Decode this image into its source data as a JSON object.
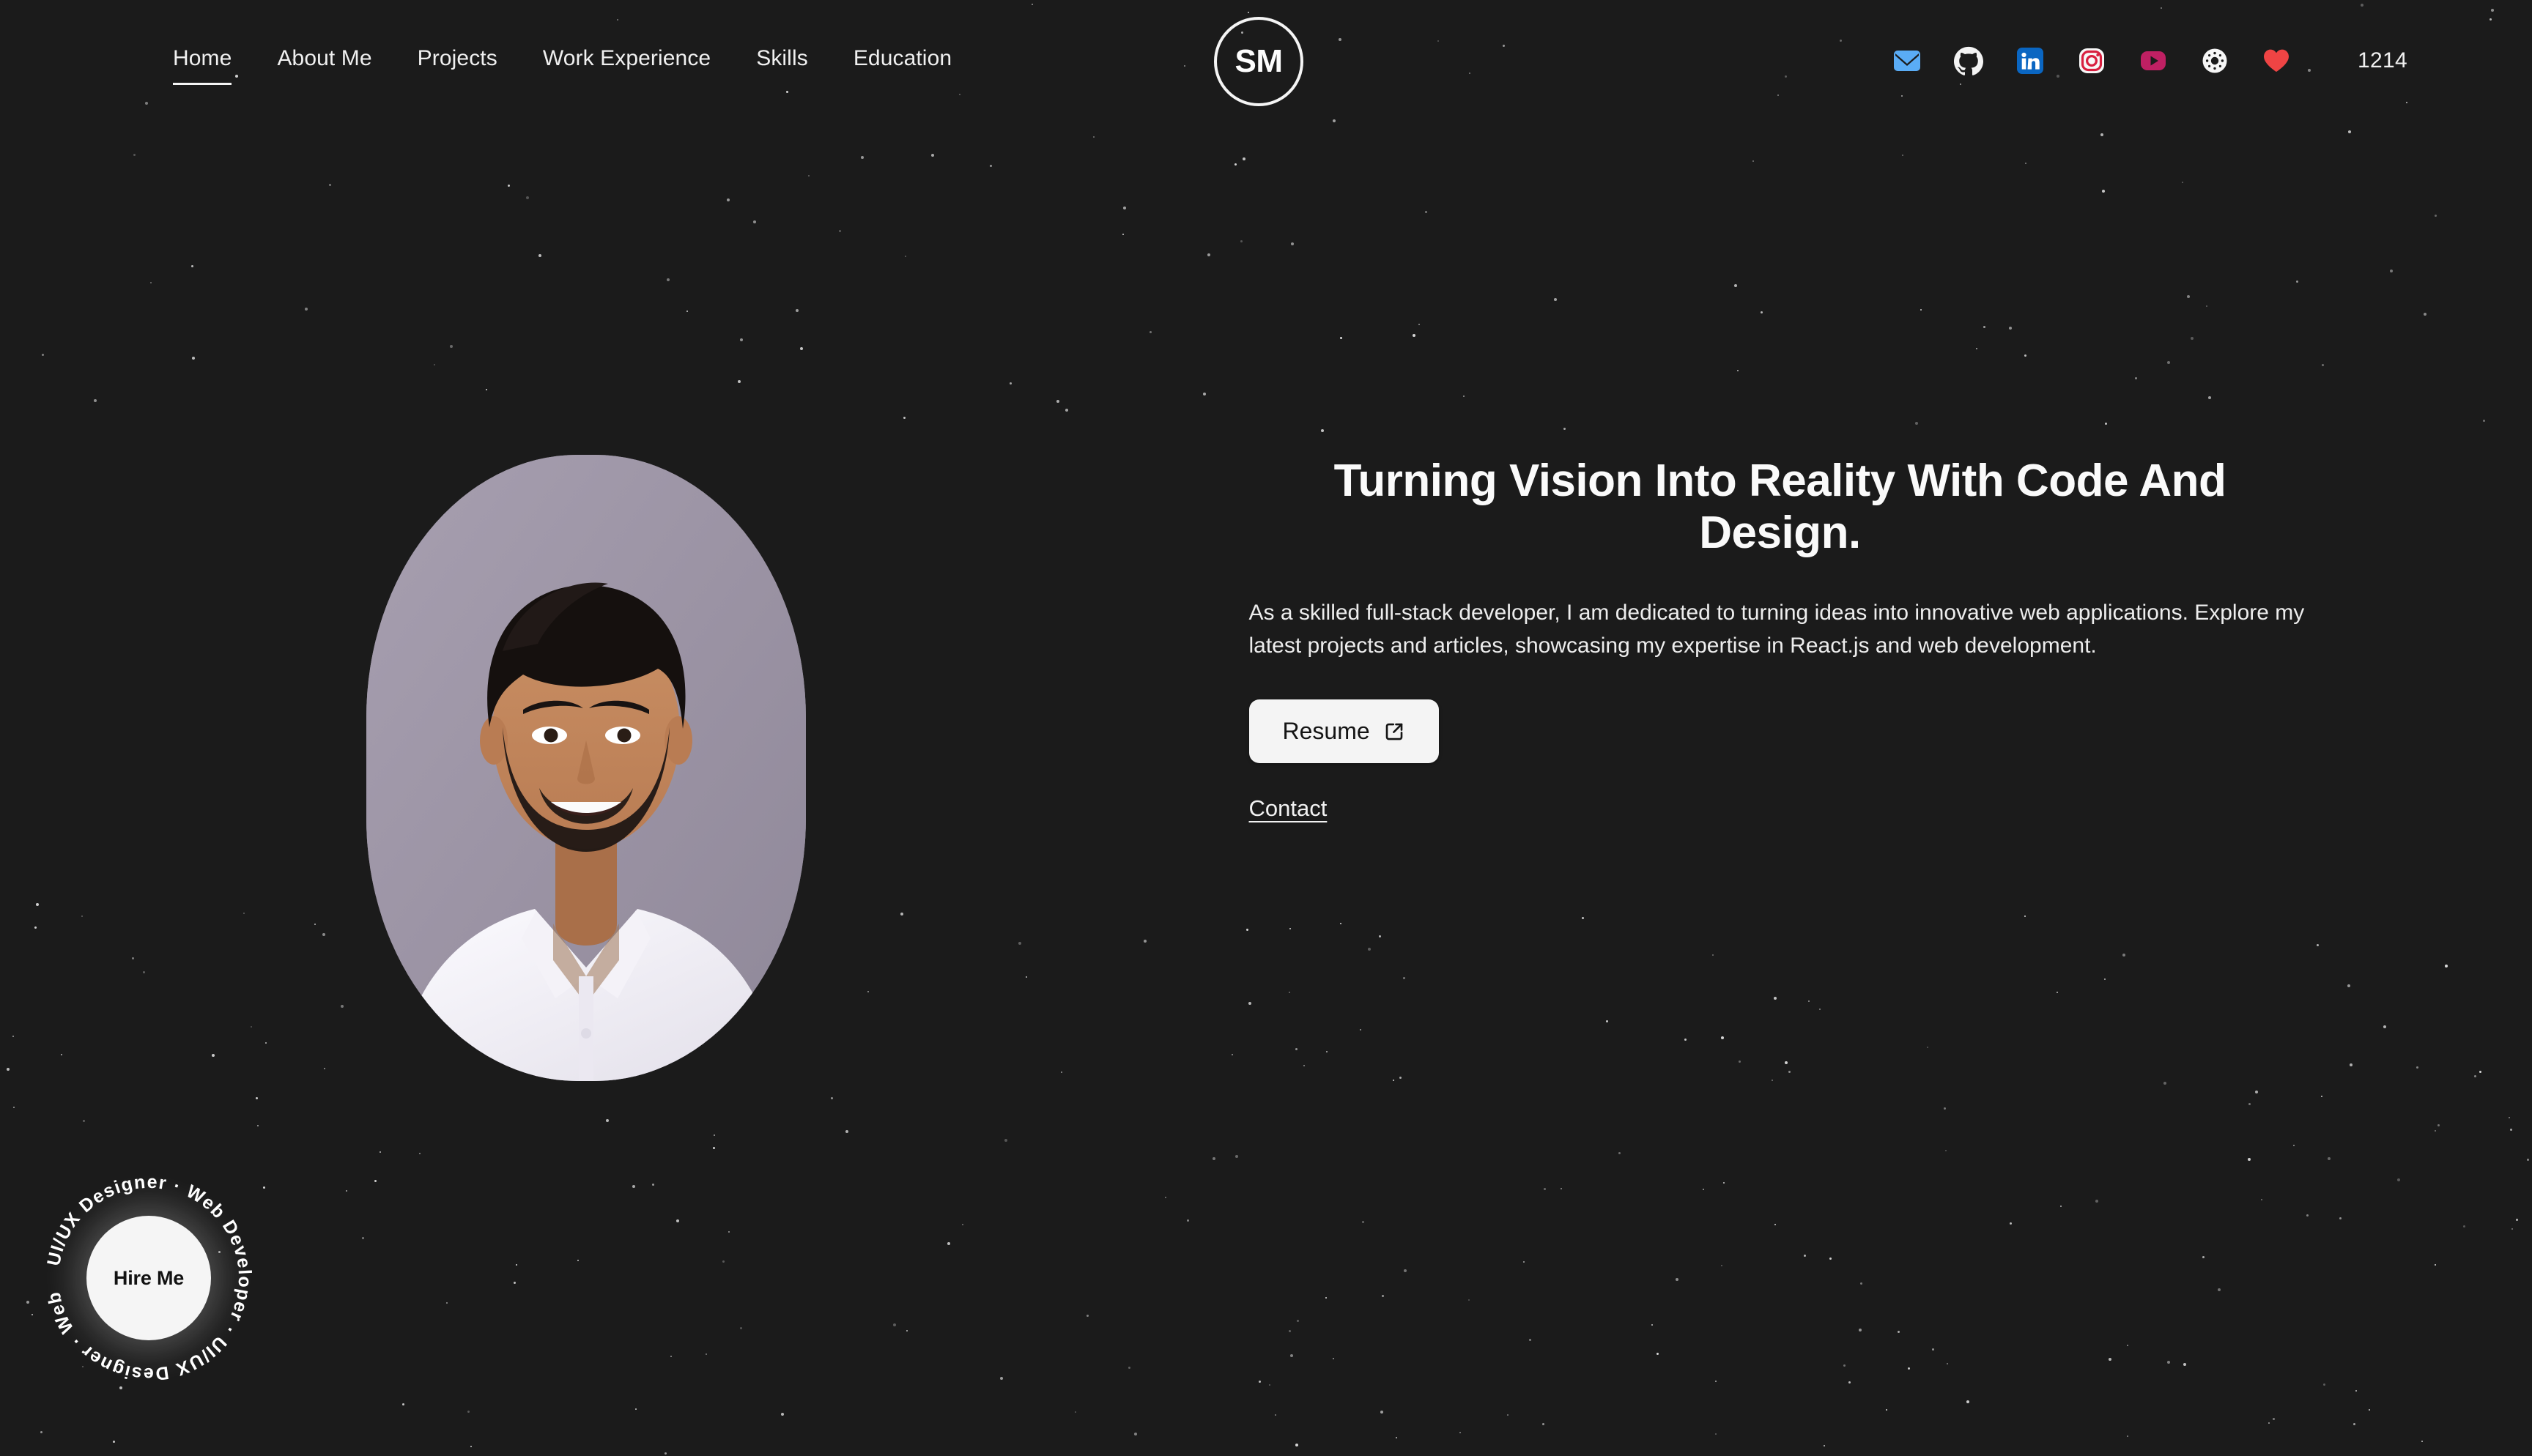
{
  "site": {
    "background_color": "#1b1b1b",
    "accent_text_color": "#f2f2f2"
  },
  "nav": {
    "logo_initials": "SM",
    "logo_name": "sm-monogram-logo",
    "items": [
      {
        "label": "Home",
        "active": true
      },
      {
        "label": "About Me",
        "active": false
      },
      {
        "label": "Projects",
        "active": false
      },
      {
        "label": "Work Experience",
        "active": false
      },
      {
        "label": "Skills",
        "active": false
      },
      {
        "label": "Education",
        "active": false
      }
    ],
    "socials": [
      {
        "name": "email-icon",
        "label": "Email",
        "color": "#5aacf5"
      },
      {
        "name": "github-icon",
        "label": "GitHub",
        "color": "#f3f3f3"
      },
      {
        "name": "linkedin-icon",
        "label": "LinkedIn",
        "color": "#0a66c2"
      },
      {
        "name": "instagram-icon",
        "label": "Instagram",
        "color": "#d81f3f"
      },
      {
        "name": "youtube-icon",
        "label": "YouTube",
        "color": "#bf2063"
      },
      {
        "name": "dribbble-icon",
        "label": "Dribbble",
        "color": "#f6f6f6"
      },
      {
        "name": "heart-icon",
        "label": "Likes",
        "color": "#ef4444"
      }
    ],
    "visit_counter": "1214"
  },
  "hero": {
    "portrait_alt": "Portrait photo of the developer smiling in a white shirt",
    "portrait_bg_color": "#9c94a4",
    "headline": "Turning Vision Into Reality With Code And Design.",
    "subtext": "As a skilled full-stack developer, I am dedicated to turning ideas into innovative web applications. Explore my latest projects and articles, showcasing my expertise in React.js and web development.",
    "resume_label": "Resume",
    "resume_icon": "external-link-icon",
    "contact_label": "Contact"
  },
  "hire_badge": {
    "center_label": "Hire Me",
    "ring_text": "UI/UX Designer · Web Developer · "
  }
}
